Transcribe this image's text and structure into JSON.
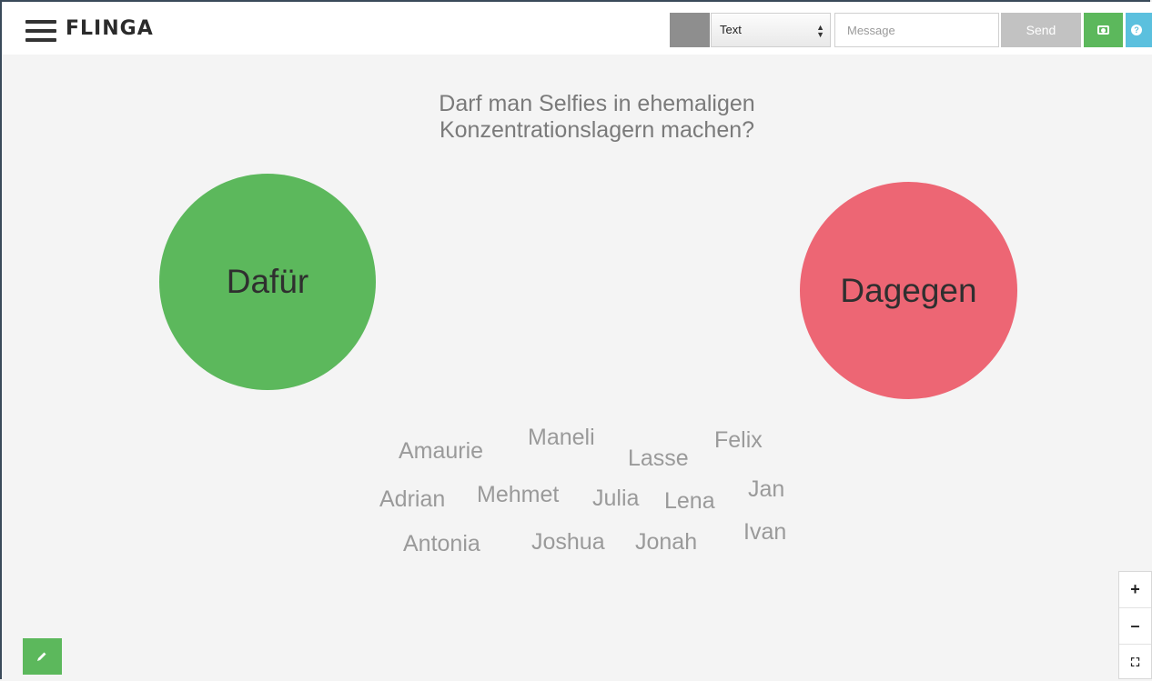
{
  "app": {
    "brand": "FLINGA"
  },
  "toolbar": {
    "select_value": "Text",
    "message_placeholder": "Message",
    "send_label": "Send",
    "color_swatch": "#8e8e8e",
    "camera_color": "#5cb85c",
    "help_color": "#5bc0de"
  },
  "board": {
    "question_line1": "Darf man Selfies in ehemaligen",
    "question_line2": "Konzentrationslagern machen?",
    "pro_label": "Dafür",
    "con_label": "Dagegen",
    "pro_color": "#5cb85c",
    "con_color": "#ed6674",
    "names": [
      "Amaurie",
      "Maneli",
      "Lasse",
      "Felix",
      "Adrian",
      "Mehmet",
      "Julia",
      "Lena",
      "Jan",
      "Antonia",
      "Joshua",
      "Jonah",
      "Ivan"
    ]
  },
  "zoom": {
    "in": "+",
    "out": "–",
    "fit": "⛶"
  },
  "icons": [
    "hamburger-icon",
    "camera-icon",
    "help-icon",
    "pencil-icon",
    "fit-icon"
  ]
}
